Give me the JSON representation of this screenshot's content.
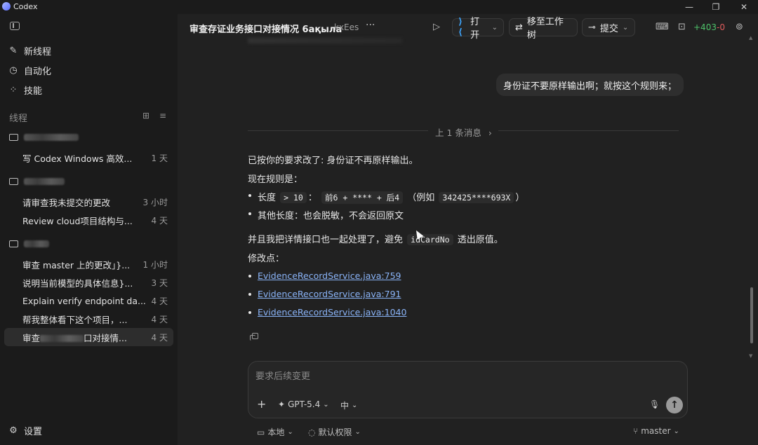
{
  "app": {
    "title": "Codex"
  },
  "window_controls": {
    "minimize": "—",
    "restore": "❐",
    "close": "✕"
  },
  "sidebar": {
    "nav": [
      {
        "label": "新线程",
        "icon": "new-thread-icon"
      },
      {
        "label": "自动化",
        "icon": "clock-icon"
      },
      {
        "label": "技能",
        "icon": "skills-icon"
      }
    ],
    "section_label": "线程",
    "groups": [
      {
        "threads": [
          {
            "title": "写 Codex Windows 高效...",
            "time": "1 天"
          }
        ]
      },
      {
        "threads": [
          {
            "title": "请审查我未提交的更改",
            "time": "3 小时"
          },
          {
            "title": "Review cloud项目结构与...",
            "time": "4 天"
          }
        ]
      },
      {
        "threads": [
          {
            "title": "审查 master 上的更改」}...",
            "time": "1 小时"
          },
          {
            "title": "说明当前模型的具体信息}...",
            "time": "3 天"
          },
          {
            "title": "Explain verify endpoint da...",
            "time": "4 天"
          },
          {
            "title": "帮我整体看下这个项目，...",
            "time": "4 天"
          },
          {
            "title_prefix": "审查",
            "title_suffix": "口对接情...",
            "time": "4 天"
          }
        ]
      }
    ],
    "settings_label": "设置"
  },
  "header": {
    "title": "审查存证业务接口对接情况 6ақыла",
    "subtitle": "kxEes",
    "more": "···",
    "open_label": "打开",
    "worktree_label": "移至工作树",
    "commit_label": "提交",
    "diff_added": "+403",
    "diff_removed": "-0"
  },
  "conversation": {
    "user_message": "身份证不要原样输出啊；就按这个规则来；",
    "divider": "上 1 条消息",
    "reply_line1": "已按你的要求改了: 身份证不再原样输出。",
    "reply_line2": "现在规则是：",
    "bullet1": {
      "label": "长度",
      "code1": "> 10",
      "sep": "：",
      "code2": "前6 + **** + 后4",
      "example_prefix": "（例如",
      "code3": "342425****693X",
      "example_suffix": "）"
    },
    "bullet2": "其他长度：也会脱敏，不会返回原文",
    "reply_line3_prefix": "并且我把详情接口也一起处理了，避免",
    "reply_line3_code": "idCardNo",
    "reply_line3_suffix": "透出原值。",
    "reply_line4": "修改点：",
    "links": [
      "EvidenceRecordService.java:759",
      "EvidenceRecordService.java:791",
      "EvidenceRecordService.java:1040"
    ]
  },
  "composer": {
    "placeholder": "要求后续变更",
    "model": "GPT-5.4",
    "effort": "中"
  },
  "footer": {
    "env": "本地",
    "permissions": "默认权限",
    "branch": "master"
  },
  "colors": {
    "accent_link": "#8ab4f8",
    "diff_add": "#4ec26a",
    "diff_del": "#e05c5c"
  }
}
